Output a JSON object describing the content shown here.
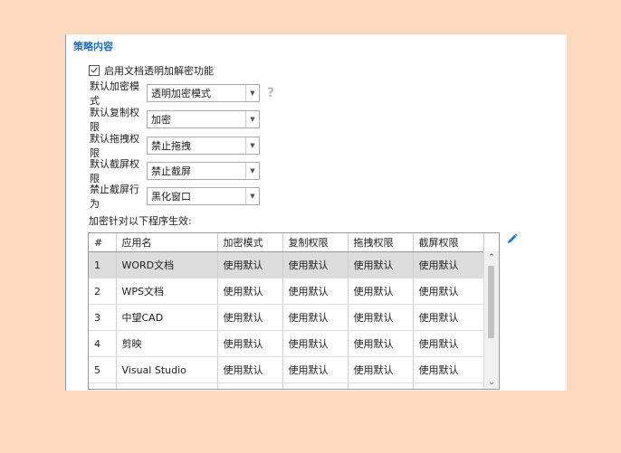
{
  "section": {
    "title": "策略内容"
  },
  "enable": {
    "label": "启用文档透明加解密功能",
    "checked": true
  },
  "form": [
    {
      "label": "默认加密模式",
      "value": "透明加密模式",
      "help": "?"
    },
    {
      "label": "默认复制权限",
      "value": "加密"
    },
    {
      "label": "默认拖拽权限",
      "value": "禁止拖拽"
    },
    {
      "label": "默认截屏权限",
      "value": "禁止截屏"
    },
    {
      "label": "禁止截屏行为",
      "value": "黑化窗口"
    }
  ],
  "table": {
    "caption": "加密针对以下程序生效:",
    "columns": [
      "#",
      "应用名",
      "加密模式",
      "复制权限",
      "拖拽权限",
      "截屏权限"
    ],
    "rows": [
      [
        "1",
        "WORD文档",
        "使用默认",
        "使用默认",
        "使用默认",
        "使用默认"
      ],
      [
        "2",
        "WPS文档",
        "使用默认",
        "使用默认",
        "使用默认",
        "使用默认"
      ],
      [
        "3",
        "中望CAD",
        "使用默认",
        "使用默认",
        "使用默认",
        "使用默认"
      ],
      [
        "4",
        "剪映",
        "使用默认",
        "使用默认",
        "使用默认",
        "使用默认"
      ],
      [
        "5",
        "Visual Studio",
        "使用默认",
        "使用默认",
        "使用默认",
        "使用默认"
      ]
    ],
    "selected_row": 0
  },
  "icons": {
    "dropdown": "chevron-down-icon",
    "help": "question-icon",
    "edit": "pencil-icon"
  },
  "colors": {
    "background": "#fdd9bf",
    "title": "#1a70c4",
    "edit_icon": "#1a78d2",
    "selected_row": "#dcdcdc"
  }
}
